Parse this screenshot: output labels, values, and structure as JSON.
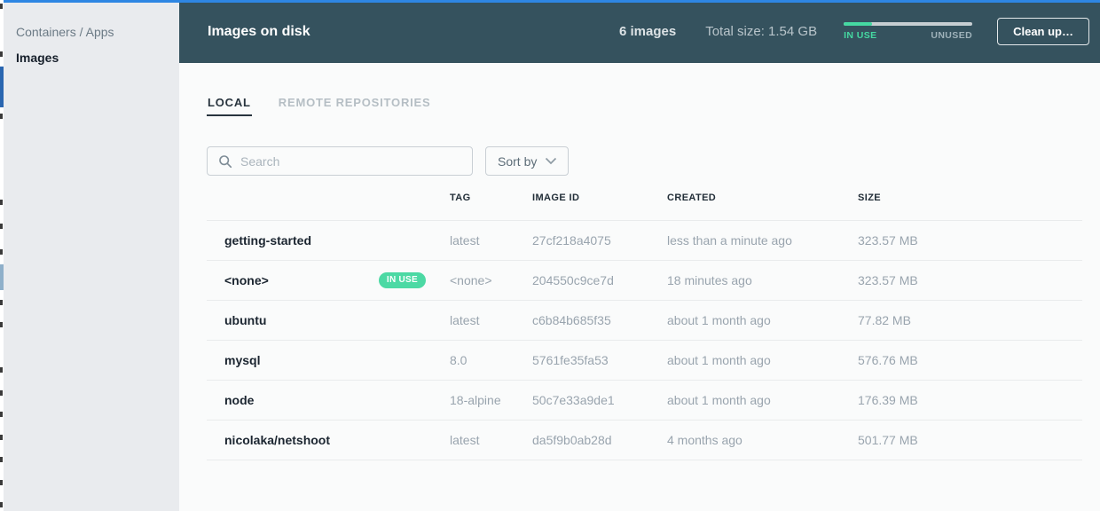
{
  "colors": {
    "accent_blue": "#2e86e3",
    "header_bg": "#35525e",
    "green": "#45d9a2",
    "sidebar_bg": "#e9ebee"
  },
  "sidebar": {
    "items": [
      {
        "label": "Containers / Apps",
        "active": false
      },
      {
        "label": "Images",
        "active": true
      }
    ]
  },
  "header": {
    "title": "Images on disk",
    "image_count": "6 images",
    "total_size": "Total size: 1.54 GB",
    "usage_bar": {
      "in_use_label": "IN USE",
      "unused_label": "UNUSED",
      "in_use_fraction": 0.22
    },
    "cleanup_label": "Clean up…"
  },
  "tabs": [
    {
      "label": "LOCAL",
      "active": true
    },
    {
      "label": "REMOTE REPOSITORIES",
      "active": false
    }
  ],
  "toolbar": {
    "search_placeholder": "Search",
    "sort_by_label": "Sort by"
  },
  "table": {
    "columns": {
      "tag": "TAG",
      "image_id": "IMAGE ID",
      "created": "CREATED",
      "size": "SIZE"
    },
    "rows": [
      {
        "name": "getting-started",
        "tag": "latest",
        "image_id": "27cf218a4075",
        "created": "less than a minute ago",
        "size": "323.57 MB"
      },
      {
        "name": "<none>",
        "badge": "IN USE",
        "tag": "<none>",
        "image_id": "204550c9ce7d",
        "created": "18 minutes ago",
        "size": "323.57 MB"
      },
      {
        "name": "ubuntu",
        "tag": "latest",
        "image_id": "c6b84b685f35",
        "created": "about 1 month ago",
        "size": "77.82 MB"
      },
      {
        "name": "mysql",
        "tag": "8.0",
        "image_id": "5761fe35fa53",
        "created": "about 1 month ago",
        "size": "576.76 MB"
      },
      {
        "name": "node",
        "tag": "18-alpine",
        "image_id": "50c7e33a9de1",
        "created": "about 1 month ago",
        "size": "176.39 MB"
      },
      {
        "name": "nicolaka/netshoot",
        "tag": "latest",
        "image_id": "da5f9b0ab28d",
        "created": "4 months ago",
        "size": "501.77 MB"
      }
    ]
  }
}
